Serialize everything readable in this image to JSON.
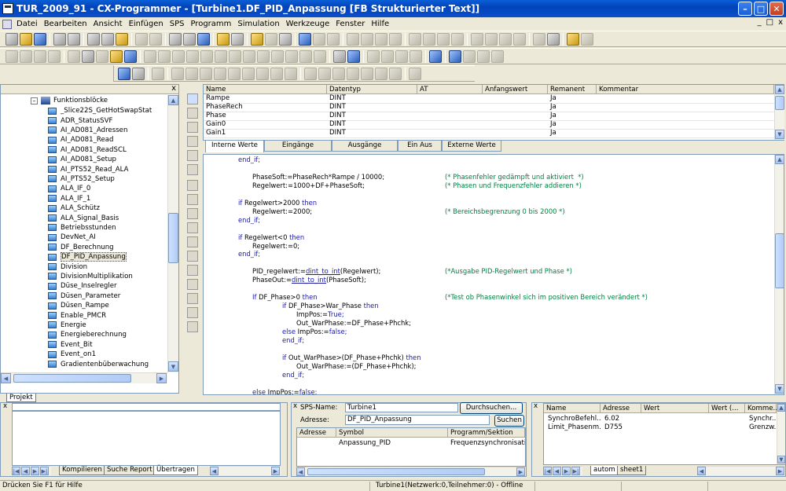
{
  "window": {
    "title": "TUR_2009_91 - CX-Programmer - [Turbine1.DF_PID_Anpassung [FB Strukturierter Text]]",
    "min": "–",
    "max": "□",
    "close": "✕",
    "mdi_min": "_",
    "mdi_restore": "□",
    "mdi_close": "x"
  },
  "menu": [
    "Datei",
    "Bearbeiten",
    "Ansicht",
    "Einfügen",
    "SPS",
    "Programm",
    "Simulation",
    "Werkzeuge",
    "Fenster",
    "Hilfe"
  ],
  "tree": {
    "root": "Funktionsblöcke",
    "expander": "–",
    "close": "x",
    "items": [
      "_Slice22S_GetHotSwapStat",
      "ADR_StatusSVF",
      "AI_AD081_Adressen",
      "AI_AD081_Read",
      "AI_AD081_ReadSCL",
      "AI_AD081_Setup",
      "AI_PTS52_Read_ALA",
      "AI_PTS52_Setup",
      "ALA_IF_0",
      "ALA_IF_1",
      "ALA_Schütz",
      "ALA_Signal_Basis",
      "Betriebsstunden",
      "DevNet_AI",
      "DF_Berechnung",
      "DF_PID_Anpassung",
      "Division",
      "DivisionMultiplikation",
      "Düse_Inselregler",
      "Düsen_Parameter",
      "Düsen_Rampe",
      "Enable_PMCR",
      "Energie",
      "Energieberechnung",
      "Event_Bit",
      "Event_on1",
      "Gradientenbüberwachung"
    ],
    "selected_index": 15,
    "tab": "Projekt"
  },
  "variables": {
    "headers": [
      "Name",
      "Datentyp",
      "AT",
      "Anfangswert",
      "Remanent",
      "Kommentar"
    ],
    "rows": [
      [
        "Rampe",
        "DINT",
        "",
        "",
        "Ja",
        ""
      ],
      [
        "PhaseRech",
        "DINT",
        "",
        "",
        "Ja",
        ""
      ],
      [
        "Phase",
        "DINT",
        "",
        "",
        "Ja",
        ""
      ],
      [
        "Gain0",
        "DINT",
        "",
        "",
        "Ja",
        ""
      ],
      [
        "Gain1",
        "DINT",
        "",
        "",
        "Ja",
        ""
      ]
    ],
    "tabs": [
      "Interne Werte",
      "Eingänge",
      "Ausgänge",
      "Ein Aus",
      "Externe Werte"
    ],
    "active_tab": 0
  },
  "code": {
    "lines": [
      {
        "i": 0,
        "segs": [
          {
            "t": "end_if;",
            "k": "kw"
          }
        ]
      },
      {
        "i": 0,
        "segs": []
      },
      {
        "i": 2,
        "segs": [
          {
            "t": "PhaseSoft:=PhaseRech*Rampe / 10000;"
          }
        ],
        "c": "(* Phasenfehler gedämpft und aktiviert  *)"
      },
      {
        "i": 2,
        "segs": [
          {
            "t": "Regelwert:=1000+DF+PhaseSoft;"
          }
        ],
        "c": "(* Phasen und Frequenzfehler addieren *)"
      },
      {
        "i": 0,
        "segs": []
      },
      {
        "i": 0,
        "segs": [
          {
            "t": "if ",
            "k": "kw"
          },
          {
            "t": "Regelwert>2000 "
          },
          {
            "t": "then",
            "k": "kw"
          }
        ]
      },
      {
        "i": 2,
        "segs": [
          {
            "t": "Regelwert:=2000;"
          }
        ],
        "c": "(* Bereichsbegrenzung 0 bis 2000 *)"
      },
      {
        "i": 0,
        "segs": [
          {
            "t": "end_if;",
            "k": "kw"
          }
        ]
      },
      {
        "i": 0,
        "segs": []
      },
      {
        "i": 0,
        "segs": [
          {
            "t": "if ",
            "k": "kw"
          },
          {
            "t": "Regelwert<0 "
          },
          {
            "t": "then",
            "k": "kw"
          }
        ]
      },
      {
        "i": 2,
        "segs": [
          {
            "t": "Regelwert:=0;"
          }
        ]
      },
      {
        "i": 0,
        "segs": [
          {
            "t": "end_if;",
            "k": "kw"
          }
        ]
      },
      {
        "i": 0,
        "segs": []
      },
      {
        "i": 1,
        "segs": [
          {
            "t": "PID_regelwert:="
          },
          {
            "t": "dint_to_int",
            "k": "kw",
            "u": true
          },
          {
            "t": "(Regelwert);"
          }
        ],
        "c": "(*Ausgabe PID-Regelwert und Phase *)"
      },
      {
        "i": 1,
        "segs": [
          {
            "t": "PhaseOut:="
          },
          {
            "t": "dint_to_int",
            "k": "kw",
            "u": true
          },
          {
            "t": "(PhaseSoft);"
          }
        ]
      },
      {
        "i": 0,
        "segs": []
      },
      {
        "i": 1,
        "segs": [
          {
            "t": "If ",
            "k": "kw"
          },
          {
            "t": "DF_Phase>0 "
          },
          {
            "t": "then",
            "k": "kw"
          }
        ],
        "c": "(*Test ob Phasenwinkel sich im positiven Bereich verändert *)"
      },
      {
        "i": 3,
        "segs": [
          {
            "t": "if ",
            "k": "kw"
          },
          {
            "t": "DF_Phase>War_Phase "
          },
          {
            "t": "then",
            "k": "kw"
          }
        ]
      },
      {
        "i": 4,
        "segs": [
          {
            "t": "ImpPos:="
          },
          {
            "t": "True;",
            "k": "kw"
          }
        ]
      },
      {
        "i": 4,
        "segs": [
          {
            "t": "Out_WarPhase:=DF_Phase+Phchk;"
          }
        ]
      },
      {
        "i": 3,
        "segs": [
          {
            "t": "else ",
            "k": "kw"
          },
          {
            "t": "ImpPos:="
          },
          {
            "t": "false;",
            "k": "kw"
          }
        ]
      },
      {
        "i": 3,
        "segs": [
          {
            "t": "end_if;",
            "k": "kw"
          }
        ]
      },
      {
        "i": 0,
        "segs": []
      },
      {
        "i": 3,
        "segs": [
          {
            "t": "if ",
            "k": "kw"
          },
          {
            "t": "Out_WarPhase>(DF_Phase+Phchk) "
          },
          {
            "t": "then",
            "k": "kw"
          }
        ]
      },
      {
        "i": 4,
        "segs": [
          {
            "t": "Out_WarPhase:=(DF_Phase+Phchk);"
          }
        ]
      },
      {
        "i": 3,
        "segs": [
          {
            "t": "end_if;",
            "k": "kw"
          }
        ]
      },
      {
        "i": 0,
        "segs": []
      },
      {
        "i": 1,
        "segs": [
          {
            "t": "else ",
            "k": "kw"
          },
          {
            "t": "ImpPos:="
          },
          {
            "t": "false;",
            "k": "kw"
          }
        ]
      }
    ]
  },
  "output_panel": {
    "tabs": [
      "Kompilieren",
      "Suche Report",
      "Übertragen"
    ],
    "active_tab": 2,
    "close": "x"
  },
  "address_panel": {
    "sps_label": "SPS-Name:",
    "sps_value": "Turbine1",
    "addr_label": "Adresse:",
    "addr_value": "DF_PID_Anpassung",
    "browse_button": "Durchsuchen...",
    "search_button": "Suchen",
    "close": "x",
    "headers": [
      "Adresse",
      "Symbol",
      "Programm/Sektion"
    ],
    "rows": [
      [
        "",
        "Anpassung_PID",
        "Frequenzsynchronisation_"
      ]
    ]
  },
  "watch_panel": {
    "headers": [
      "Name",
      "Adresse",
      "Wert",
      "Wert (...",
      "Komme..."
    ],
    "rows": [
      [
        "SynchroBefehl...",
        "6.02",
        "",
        "",
        "Synchr..."
      ],
      [
        "Limit_Phasenm...",
        "D755",
        "",
        "",
        "Grenzw..."
      ]
    ],
    "tabs": [
      "autom",
      "sheet1"
    ],
    "active_tab": 0,
    "close": "x"
  },
  "status": {
    "help": "Drücken Sie F1 für Hilfe",
    "connection": "Turbine1(Netzwerk:0,Teilnehmer:0) - Offline"
  },
  "colors": {
    "titlebar": "#0a4fcc",
    "keyword": "#1a1aa8",
    "comment": "#008040"
  }
}
